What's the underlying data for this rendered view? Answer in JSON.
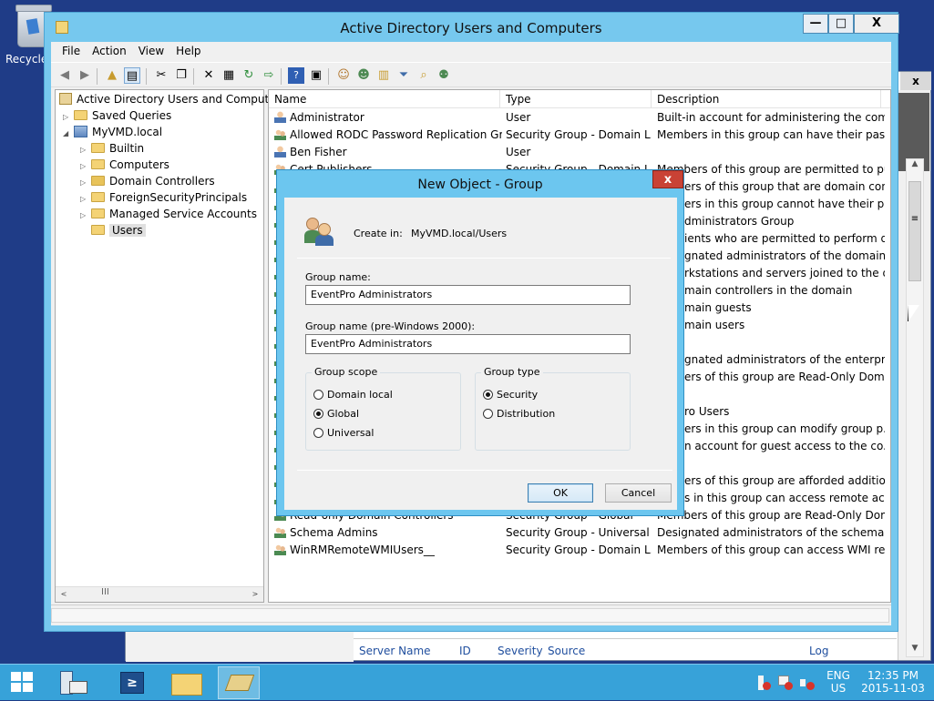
{
  "desktop": {
    "recycle_label": "Recycle"
  },
  "bg_window": {
    "close_glyph": "x",
    "grip_glyph": "≡",
    "columns": [
      "Server Name",
      "ID",
      "Severity",
      "Source",
      "Log"
    ]
  },
  "window": {
    "title": "Active Directory Users and Computers",
    "controls": {
      "minimize": "—",
      "maximize": "□",
      "close": "X"
    },
    "menu": [
      "File",
      "Action",
      "View",
      "Help"
    ]
  },
  "tree": {
    "root": "Active Directory Users and Computers [",
    "items": [
      {
        "label": "Saved Queries",
        "level": 1,
        "expander": "▷"
      },
      {
        "label": "MyVMD.local",
        "level": 1,
        "expander": "◢"
      },
      {
        "label": "Builtin",
        "level": 2,
        "expander": "▷"
      },
      {
        "label": "Computers",
        "level": 2,
        "expander": "▷"
      },
      {
        "label": "Domain Controllers",
        "level": 2,
        "expander": "▷"
      },
      {
        "label": "ForeignSecurityPrincipals",
        "level": 2,
        "expander": "▷"
      },
      {
        "label": "Managed Service Accounts",
        "level": 2,
        "expander": "▷"
      },
      {
        "label": "Users",
        "level": 2,
        "expander": "",
        "selected": true
      }
    ],
    "hscroll_left": "<",
    "hscroll_mid": "III",
    "hscroll_right": ">"
  },
  "list": {
    "columns": [
      "Name",
      "Type",
      "Description"
    ],
    "top_rows": [
      {
        "name": "Administrator",
        "type": "User",
        "desc": "Built-in account for administering the com...",
        "icon": "user-icon"
      },
      {
        "name": "Allowed RODC Password Replication Group",
        "type": "Security Group - Domain L...",
        "desc": "Members in this group can have their passw...",
        "icon": "group-icon"
      },
      {
        "name": "Ben Fisher",
        "type": "User",
        "desc": "",
        "icon": "user-icon"
      },
      {
        "name": "Cert Publishers",
        "type": "Security Group - Domain L...",
        "desc": "Members of this group are permitted to pu...",
        "icon": "group-icon"
      }
    ],
    "partial_desc": [
      "ers of this group that are domain con...",
      "ers in this group cannot have their pa...",
      "dministrators Group",
      "ients who are permitted to perform d...",
      "gnated administrators of the domain",
      "rkstations and servers joined to the d...",
      "main controllers in the domain",
      "main guests",
      "main users",
      "",
      "gnated administrators of the enterprise",
      "ers of this group are Read-Only Dom...",
      "",
      "ro Users",
      "ers in this group can modify group p...",
      "n account for guest access to the co...",
      "",
      "ers of this group are afforded additio...",
      "s in this group can access remote acc..."
    ],
    "bottom_rows": [
      {
        "name": "Read-only Domain Controllers",
        "type": "Security Group - Global",
        "desc": "Members of this group are Read-Only Dom...",
        "icon": "group-icon"
      },
      {
        "name": "Schema Admins",
        "type": "Security Group - Universal",
        "desc": "Designated administrators of the schema",
        "icon": "group-icon"
      },
      {
        "name": "WinRMRemoteWMIUsers__",
        "type": "Security Group - Domain L...",
        "desc": "Members of this group can access WMI res...",
        "icon": "group-icon"
      }
    ]
  },
  "dialog": {
    "title": "New Object - Group",
    "close_glyph": "x",
    "create_in_label": "Create in:",
    "create_in_value": "MyVMD.local/Users",
    "group_name_label": "Group name:",
    "group_name_value": "EventPro Administrators",
    "group_name_pre2000_label": "Group name (pre-Windows 2000):",
    "group_name_pre2000_value": "EventPro Administrators",
    "scope": {
      "legend": "Group scope",
      "options": [
        "Domain local",
        "Global",
        "Universal"
      ],
      "selected": "Global"
    },
    "type": {
      "legend": "Group type",
      "options": [
        "Security",
        "Distribution"
      ],
      "selected": "Security"
    },
    "ok": "OK",
    "cancel": "Cancel"
  },
  "taskbar": {
    "lang": "ENG",
    "region": "US",
    "time": "12:35 PM",
    "date": "2015-11-03"
  },
  "colors": {
    "accent": "#76c8ee",
    "taskbar": "#37a2d9",
    "desktop": "#1f3c87",
    "dialog_close": "#c94235"
  }
}
